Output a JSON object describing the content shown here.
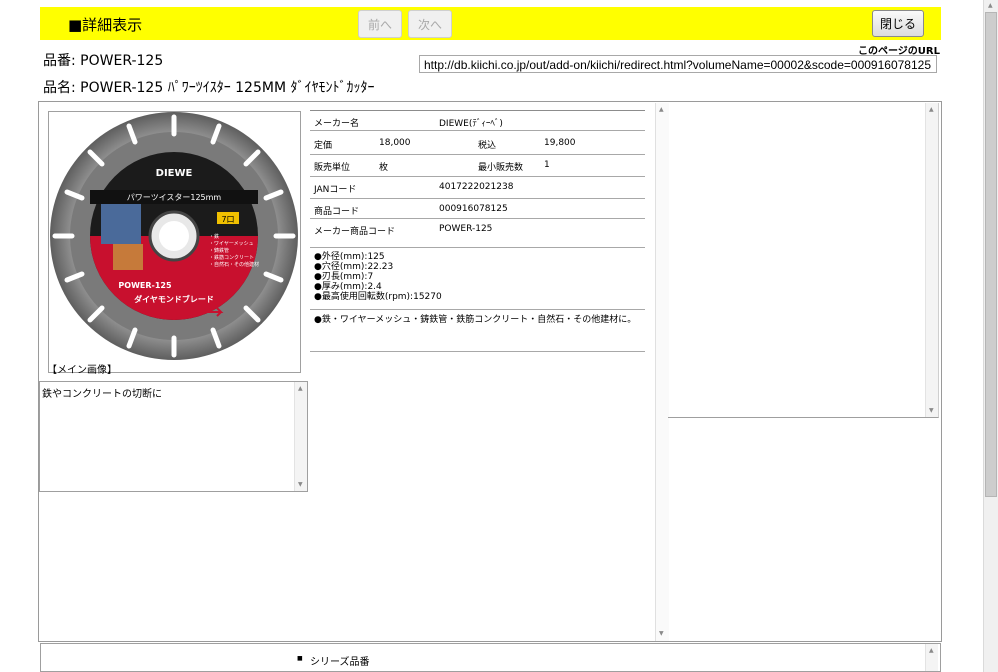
{
  "header": {
    "title": "■詳細表示",
    "prev_label": "前へ",
    "next_label": "次へ",
    "close_label": "閉じる"
  },
  "product": {
    "number_line": "品番: POWER-125",
    "name_line": "品名: POWER-125 ﾊﾟﾜｰﾂｲｽﾀｰ 125MM ﾀﾞｲﾔﾓﾝﾄﾞｶｯﾀｰ"
  },
  "url": {
    "label": "このページのURL",
    "value": "http://db.kiichi.co.jp/out/add-on/kiichi/redirect.html?volumeName=00002&scode=000916078125"
  },
  "image": {
    "caption": "【メイン画像】",
    "brand": "DIEWE",
    "label_top": "パワーツイスター125mm",
    "badge": "7口",
    "model": "POWER-125",
    "banner": "ダイヤモンドブレード",
    "uses": [
      "・鉄",
      "・ワイヤーメッシュ",
      "・鋳鉄管",
      "・鉄筋コンクリート",
      "・自然石・その他建材"
    ]
  },
  "note": "鉄やコンクリートの切断に",
  "specs": {
    "maker_label": "メーカー名",
    "maker_value": "DIEWE(ﾃﾞｨｰﾍﾞ)",
    "price_label": "定価",
    "price_value": "18,000",
    "tax_label": "税込",
    "tax_value": "19,800",
    "unit_label": "販売単位",
    "unit_value": "枚",
    "min_label": "最小販売数",
    "min_value": "1",
    "jan_label": "JANコード",
    "jan_value": "4017222021238",
    "code_label": "商品コード",
    "code_value": "000916078125",
    "maker_code_label": "メーカー商品コード",
    "maker_code_value": "POWER-125",
    "details": [
      "●外径(mm):125",
      "●穴径(mm):22.23",
      "●刃長(mm):7",
      "●厚み(mm):2.4",
      "●最高使用回転数(rpm):15270"
    ],
    "materials": "●鉄・ワイヤーメッシュ・鋳鉄管・鉄筋コンクリート・自然石・その他建材に。"
  },
  "bottom": {
    "series_label": "シリーズ品番"
  }
}
